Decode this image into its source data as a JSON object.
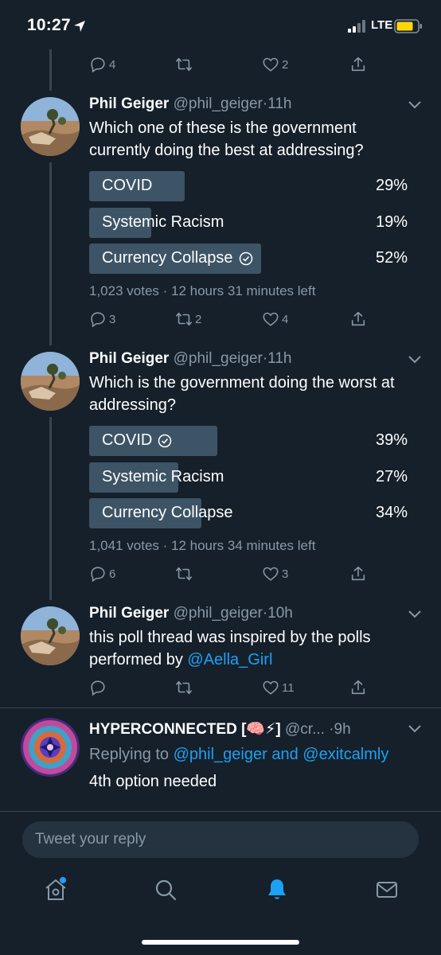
{
  "status": {
    "time": "10:27",
    "network": "LTE"
  },
  "top_actions": {
    "replies": "4",
    "retweets": "",
    "likes": "2"
  },
  "tweets": [
    {
      "name": "Phil Geiger",
      "handle": "@phil_geiger",
      "sep": "·",
      "time": "11h",
      "text": "Which one of these is the government currently doing the best at addressing?",
      "poll": [
        {
          "label": "COVID",
          "pct": "29%",
          "fraction": 0.29,
          "winner": false
        },
        {
          "label": "Systemic Racism",
          "pct": "19%",
          "fraction": 0.19,
          "winner": false
        },
        {
          "label": "Currency Collapse",
          "pct": "52%",
          "fraction": 0.52,
          "winner": true
        }
      ],
      "meta": "1,023 votes · 12 hours 31 minutes left",
      "actions": {
        "replies": "3",
        "retweets": "2",
        "likes": "4"
      }
    },
    {
      "name": "Phil Geiger",
      "handle": "@phil_geiger",
      "sep": "·",
      "time": "11h",
      "text": "Which is the government doing the worst at addressing?",
      "poll": [
        {
          "label": "COVID",
          "pct": "39%",
          "fraction": 0.39,
          "winner": true
        },
        {
          "label": "Systemic Racism",
          "pct": "27%",
          "fraction": 0.27,
          "winner": false
        },
        {
          "label": "Currency Collapse",
          "pct": "34%",
          "fraction": 0.34,
          "winner": false
        }
      ],
      "meta": "1,041 votes · 12 hours 34 minutes left",
      "actions": {
        "replies": "6",
        "retweets": "",
        "likes": "3"
      }
    },
    {
      "name": "Phil Geiger",
      "handle": "@phil_geiger",
      "sep": "·",
      "time": "10h",
      "text_prefix": "this poll thread was inspired by the polls performed by ",
      "text_link": "@Aella_Girl",
      "actions": {
        "replies": "",
        "retweets": "",
        "likes": "11"
      }
    },
    {
      "name": "HYPERCONNECTED [🧠⚡]",
      "handle": "@cr...",
      "sep": "·",
      "time": "9h",
      "replying_prefix": "Replying to ",
      "replying_link": "@phil_geiger and @exitcalmly",
      "text": "4th option needed"
    }
  ],
  "composer": {
    "placeholder": "Tweet your reply"
  },
  "tabbar": [
    "home-icon",
    "search-icon",
    "notifications-icon",
    "messages-icon"
  ],
  "colors": {
    "background": "#15202b",
    "accent": "#1da1f2",
    "muted": "#8899a6",
    "poll_bar": "#3d5466"
  }
}
